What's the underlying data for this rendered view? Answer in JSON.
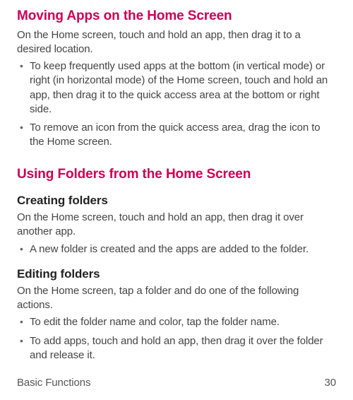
{
  "s1": {
    "title": "Moving Apps on the Home Screen",
    "intro": "On the Home screen, touch and hold an app, then drag it to a desired location.",
    "bullets": [
      "To keep frequently used apps at the bottom (in vertical mode) or right (in horizontal mode) of the Home screen, touch and hold an app, then drag it to the quick access area at the bottom or right side.",
      "To remove an icon from the quick access area, drag the icon to the Home screen."
    ]
  },
  "s2": {
    "title": "Using Folders from the Home Screen",
    "sub1": {
      "title": "Creating folders",
      "intro": "On the Home screen, touch and hold an app, then drag it over another app.",
      "bullets": [
        "A new folder is created and the apps are added to the folder."
      ]
    },
    "sub2": {
      "title": "Editing folders",
      "intro": "On the Home screen, tap a folder and do one of the following actions.",
      "bullets": [
        "To edit the folder name and color, tap the folder name.",
        "To add apps, touch and hold an app, then drag it over the folder and release it."
      ]
    }
  },
  "footer": {
    "section": "Basic Functions",
    "page": "30"
  }
}
